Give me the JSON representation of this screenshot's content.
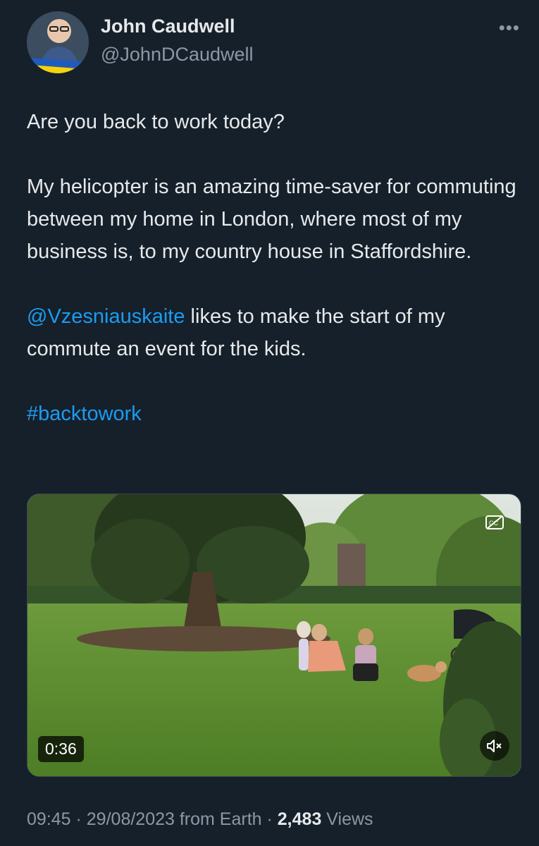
{
  "author": {
    "name": "John Caudwell",
    "handle": "@JohnDCaudwell",
    "avatar_badge": "I Stand With Ukraine"
  },
  "menu": {
    "more_label": "•••"
  },
  "tweet": {
    "line1": "Are you back to work today?",
    "para2": "My helicopter is an amazing time-saver for commuting between my home in London, where most of my business is, to my country house in Staffordshire.",
    "mention": "@Vzesniauskaite",
    "para3_rest": " likes to make the start of my commute an event for the kids.",
    "hashtag": "#backtowork"
  },
  "media": {
    "duration": "0:36",
    "icons": {
      "captions": "closed-captions-icon",
      "mute": "muted-speaker-icon"
    }
  },
  "meta": {
    "time": "09:45",
    "separator": " · ",
    "date": "29/08/2023",
    "source": " from Earth",
    "views_count": "2,483",
    "views_label": " Views"
  },
  "colors": {
    "background": "#15202b",
    "text": "#e7e9ea",
    "muted": "#8b98a5",
    "link": "#1d9bf0"
  }
}
